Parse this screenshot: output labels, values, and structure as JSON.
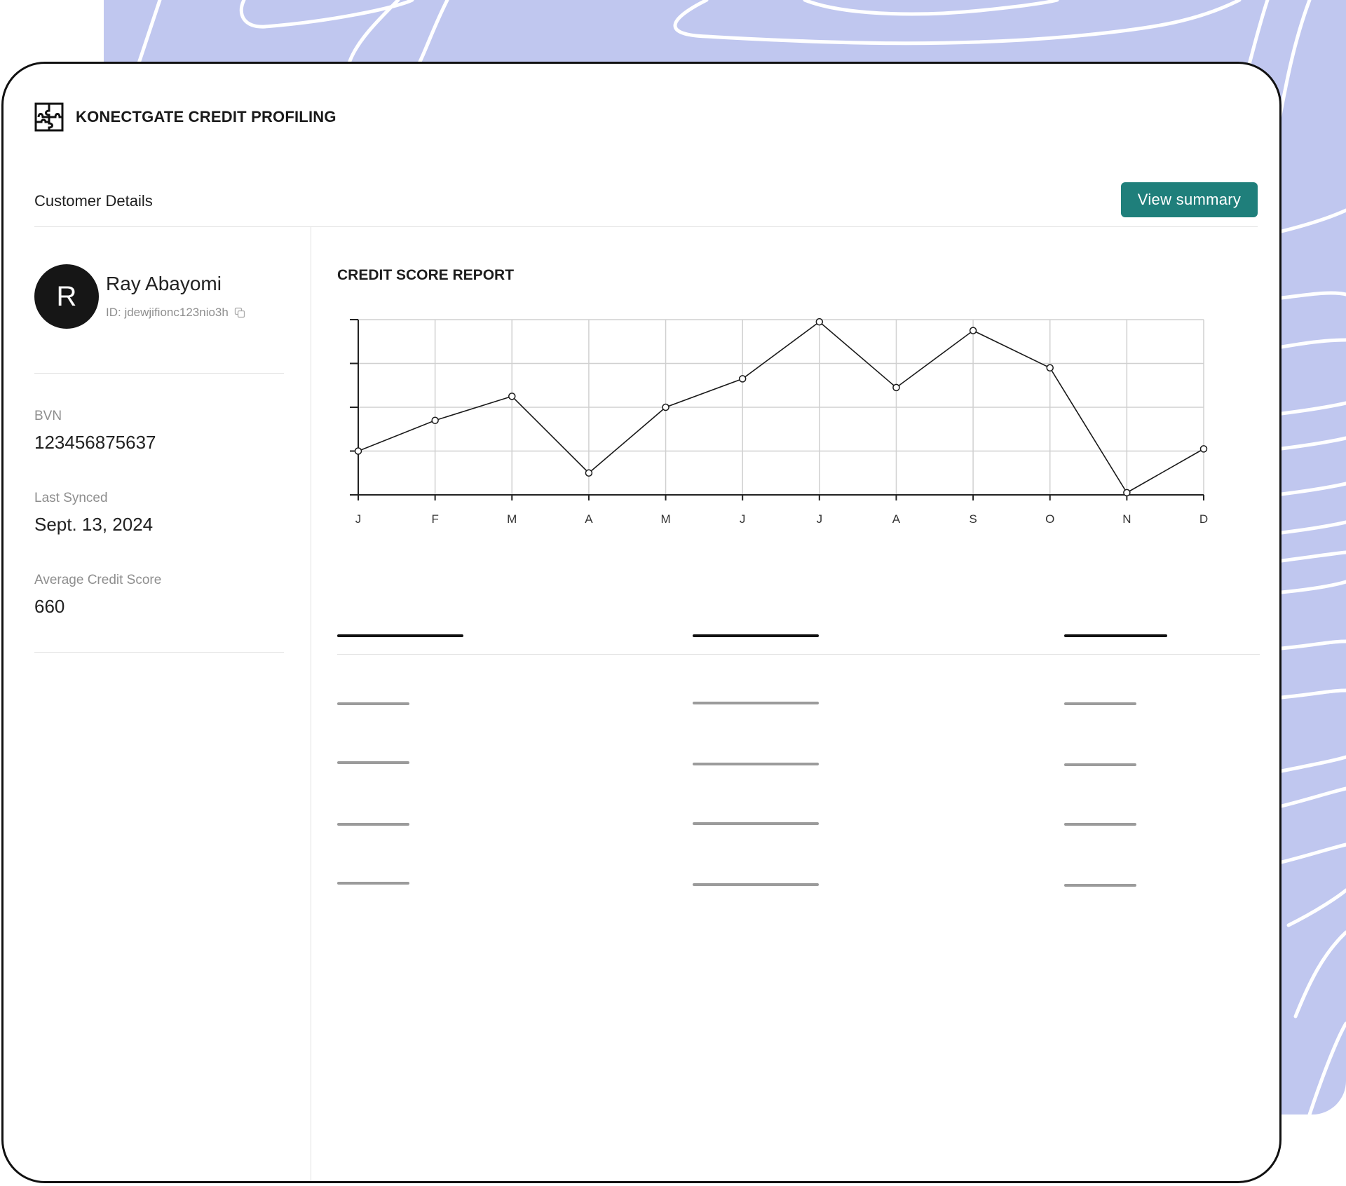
{
  "app": {
    "brand_title": "KONECTGATE CREDIT PROFILING",
    "logo_icon": "puzzle-logo-icon"
  },
  "header": {
    "section_title": "Customer Details",
    "view_summary_label": "View summary"
  },
  "customer": {
    "avatar_initial": "R",
    "name": "Ray Abayomi",
    "id_text": "ID: jdewjifionc123nio3h",
    "copy_icon": "copy-icon",
    "fields": [
      {
        "label": "BVN",
        "value": "123456875637"
      },
      {
        "label": "Last Synced",
        "value": "Sept. 13, 2024"
      },
      {
        "label": "Average Credit Score",
        "value": "660"
      }
    ]
  },
  "colors": {
    "accent": "#1f7f7b",
    "background_card": "#c0c7ef",
    "avatar": "#161616"
  },
  "report": {
    "title": "CREDIT SCORE REPORT"
  },
  "chart_data": {
    "type": "line",
    "title": "CREDIT SCORE REPORT",
    "categories": [
      "J",
      "F",
      "M",
      "A",
      "M",
      "J",
      "J",
      "A",
      "S",
      "O",
      "N",
      "D"
    ],
    "values": [
      1.0,
      1.7,
      2.25,
      0.5,
      2.0,
      2.65,
      3.95,
      2.45,
      3.75,
      2.9,
      0.05,
      1.05
    ],
    "ylim": [
      0,
      4
    ],
    "y_tick_labels": [],
    "xlabel": "",
    "ylabel": "",
    "grid": true,
    "legend": "none"
  }
}
